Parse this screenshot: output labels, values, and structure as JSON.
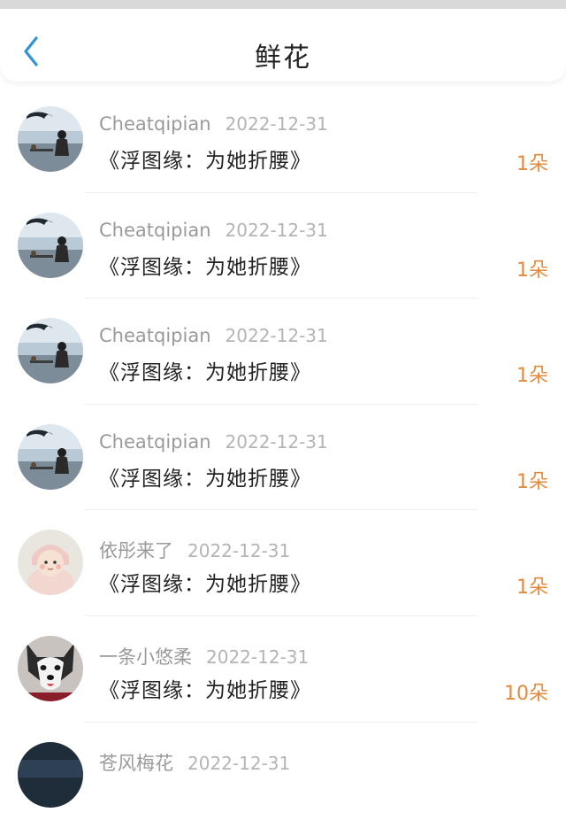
{
  "header": {
    "title": "鲜花"
  },
  "colors": {
    "accent_back": "#2f95d6",
    "count": "#e48a3d"
  },
  "rows": [
    {
      "user": "Cheatqipian",
      "date": "2022-12-31",
      "work": "《浮图缘：为她折腰》",
      "count": "1朵",
      "avatar": "seaside-photo"
    },
    {
      "user": "Cheatqipian",
      "date": "2022-12-31",
      "work": "《浮图缘：为她折腰》",
      "count": "1朵",
      "avatar": "seaside-photo"
    },
    {
      "user": "Cheatqipian",
      "date": "2022-12-31",
      "work": "《浮图缘：为她折腰》",
      "count": "1朵",
      "avatar": "seaside-photo"
    },
    {
      "user": "Cheatqipian",
      "date": "2022-12-31",
      "work": "《浮图缘：为她折腰》",
      "count": "1朵",
      "avatar": "seaside-photo"
    },
    {
      "user": "依彤来了",
      "date": "2022-12-31",
      "work": "《浮图缘：为她折腰》",
      "count": "1朵",
      "avatar": "baby-photo"
    },
    {
      "user": "一条小悠柔",
      "date": "2022-12-31",
      "work": "《浮图缘：为她折腰》",
      "count": "10朵",
      "avatar": "husky-photo"
    },
    {
      "user": "苍风梅花",
      "date": "2022-12-31",
      "work": "",
      "count": "",
      "avatar": "dark-photo"
    }
  ]
}
